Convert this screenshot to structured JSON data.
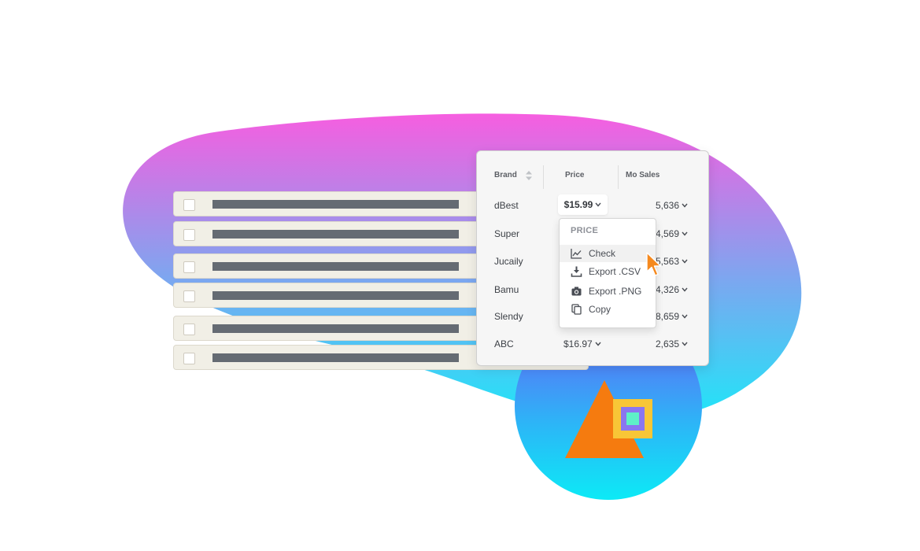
{
  "table": {
    "headers": {
      "brand": "Brand",
      "price": "Price",
      "sales": "Mo Sales"
    },
    "rows": [
      {
        "brand": "dBest",
        "price": "$15.99",
        "sales": "5,636"
      },
      {
        "brand": "Super",
        "price": "",
        "sales": "4,569"
      },
      {
        "brand": "Jucaily",
        "price": "",
        "sales": "5,563"
      },
      {
        "brand": "Bamu",
        "price": "",
        "sales": "4,326"
      },
      {
        "brand": "Slendy",
        "price": "",
        "sales": "8,659"
      },
      {
        "brand": "ABC",
        "price": "$16.97",
        "sales": "2,635"
      }
    ]
  },
  "menu": {
    "header": "PRICE",
    "items": [
      {
        "label": "Check",
        "icon": "line-chart-icon"
      },
      {
        "label": "Export .CSV",
        "icon": "download-icon"
      },
      {
        "label": "Export .PNG",
        "icon": "camera-icon"
      },
      {
        "label": "Copy",
        "icon": "copy-icon"
      }
    ]
  },
  "colors": {
    "blob_top": "#f65ee0",
    "blob_bottom": "#1ee6f8",
    "circle_top": "#6a5cf6",
    "circle_bottom": "#0ceaf6",
    "accent_orange": "#f57b0f",
    "accent_yellow": "#f8c637",
    "cursor": "#f5891e"
  }
}
